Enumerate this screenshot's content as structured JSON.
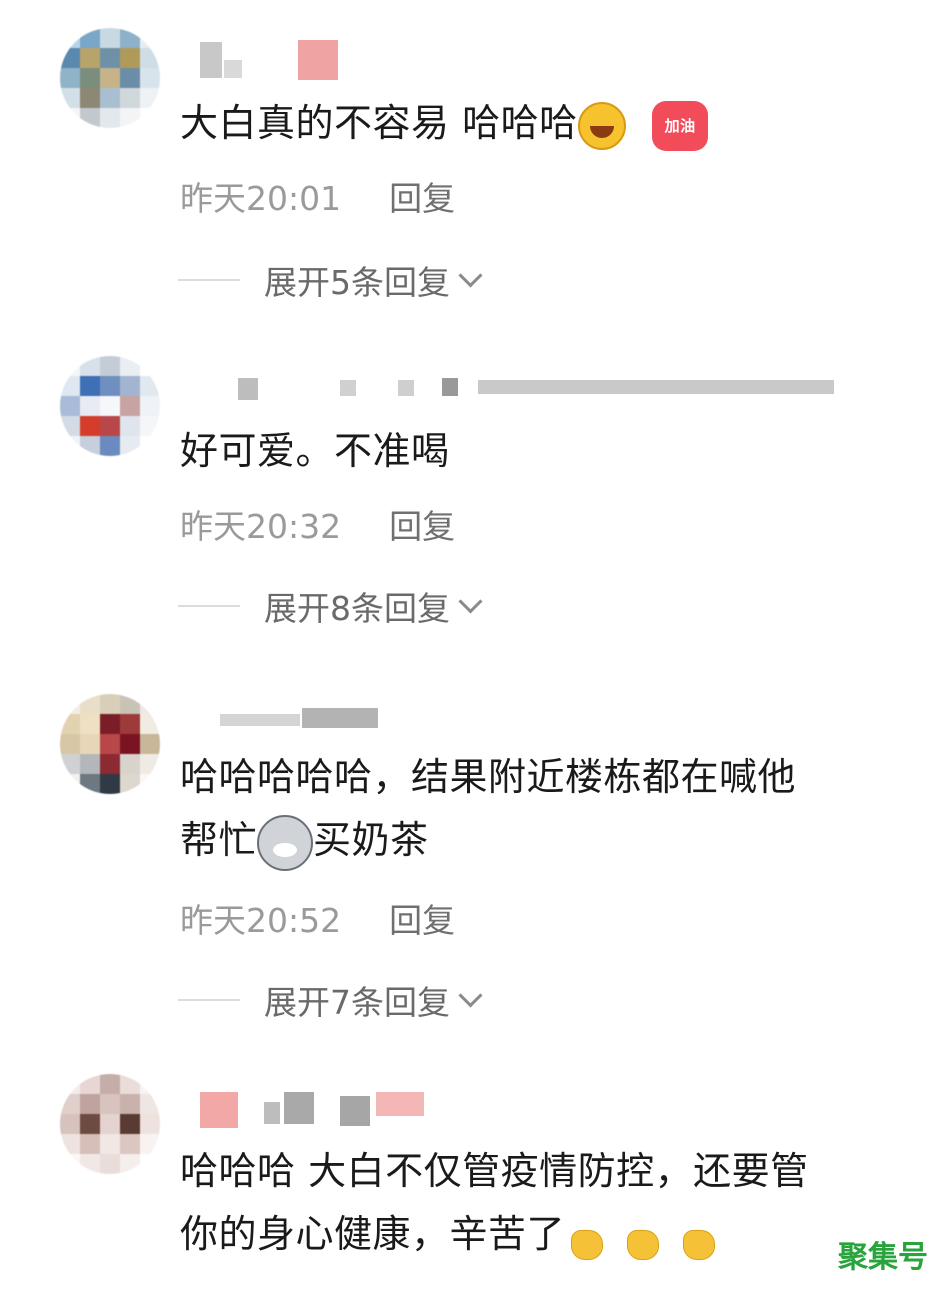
{
  "comments": [
    {
      "text": "大白真的不容易 哈哈哈",
      "emojis": [
        "laughing-tears",
        "jiayou-heart"
      ],
      "emoji_label": "加油",
      "time": "昨天20:01",
      "reply_label": "回复",
      "expand_label": "展开5条回复"
    },
    {
      "text": "好可爱。不准喝",
      "time": "昨天20:32",
      "reply_label": "回复",
      "expand_label": "展开8条回复"
    },
    {
      "text_line1": "哈哈哈哈哈，结果附近楼栋都在喊他",
      "text_line2_a": "帮忙",
      "text_line2_b": "买奶茶",
      "emojis": [
        "doge"
      ],
      "time": "昨天20:52",
      "reply_label": "回复",
      "expand_label": "展开7条回复"
    },
    {
      "text_line1": "哈哈哈 大白不仅管疫情防控，还要管",
      "text_line2": "你的身心健康，辛苦了",
      "emojis": [
        "finger-heart",
        "finger-heart",
        "finger-heart"
      ]
    }
  ],
  "watermark": "聚集号",
  "colors": {
    "text": "#1a1a1a",
    "meta": "#9a9a9a",
    "watermark": "#29a43d"
  }
}
